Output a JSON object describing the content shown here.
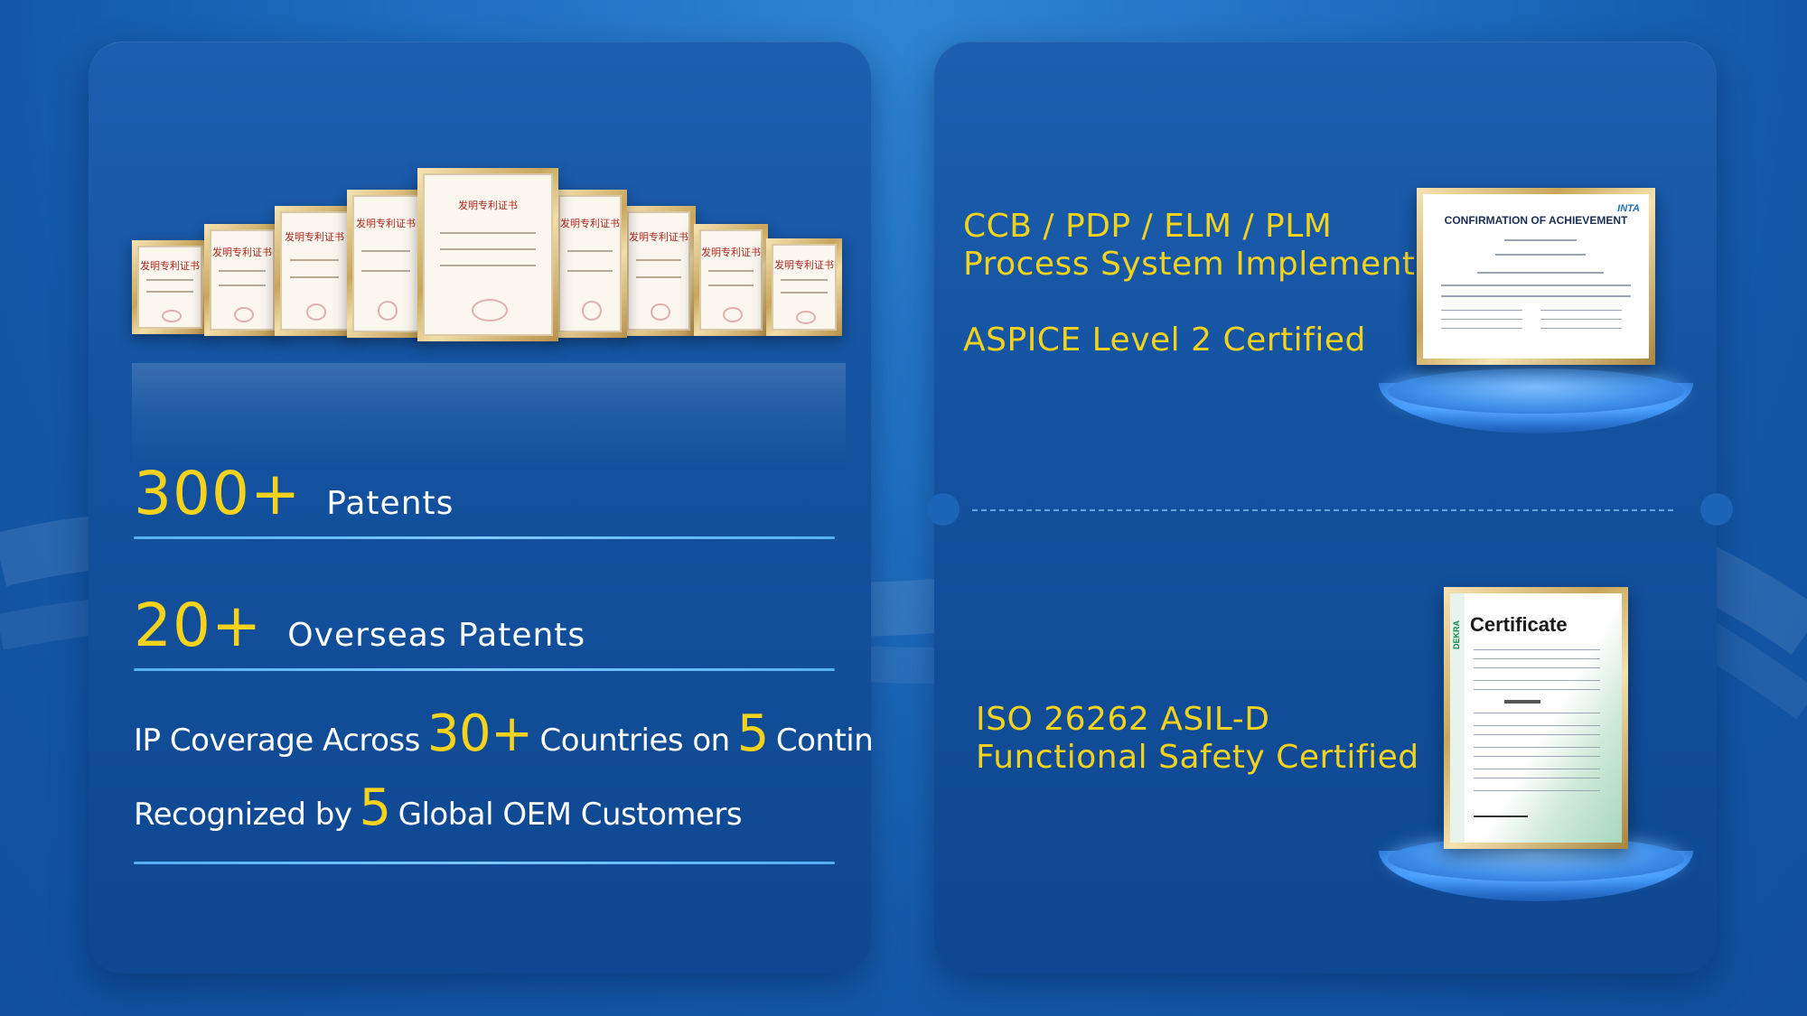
{
  "left": {
    "stat1": {
      "value": "300+",
      "label": "Patents"
    },
    "stat2": {
      "value": "20+",
      "label": "Overseas Patents"
    },
    "line1": {
      "pre": "IP Coverage Across",
      "n1": "30+",
      "mid": "Countries on",
      "n2": "5",
      "post": "Continents"
    },
    "line2": {
      "pre": "Recognized by",
      "n1": "5",
      "post": "Global OEM Customers"
    },
    "certs": {
      "title": "发明专利证书"
    }
  },
  "right": {
    "block1": {
      "line1": "CCB / PDP / ELM / PLM",
      "line2": "Process System Implemented",
      "line3": "ASPICE Level 2 Certified"
    },
    "block2": {
      "line1": "ISO 26262 ASIL-D",
      "line2": "Functional Safety Certified"
    },
    "aspice_cert": {
      "title": "CONFIRMATION OF ACHIEVEMENT",
      "logo": "INTA"
    },
    "iso_cert": {
      "title": "Certificate",
      "logo": "DEKRA"
    }
  },
  "colors": {
    "accent": "#f5d21c",
    "background": "#1358a8",
    "divider": "#7dc8ff"
  }
}
